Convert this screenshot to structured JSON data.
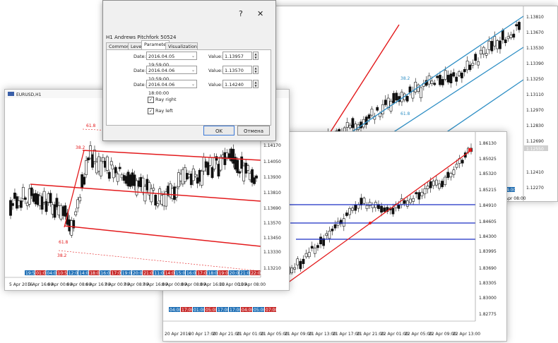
{
  "dialog": {
    "title": "H1 Andrews Pitchfork 50524",
    "help_label": "?",
    "close_label": "✕",
    "tabs": [
      "Common",
      "Levels",
      "Parameters",
      "Visualization"
    ],
    "active_tab": "Parameters",
    "rows": [
      {
        "date_label": "Date:",
        "date": "2016.04.05 19:59:00",
        "value_label": "Value:",
        "value": "1.13957"
      },
      {
        "date_label": "Date:",
        "date": "2016.04.06 10:59:00",
        "value_label": "Value:",
        "value": "1.13570"
      },
      {
        "date_label": "Date:",
        "date": "2016.04.06 18:00:00",
        "value_label": "Value:",
        "value": "1.14240"
      }
    ],
    "ray_right_label": "Ray right",
    "ray_left_label": "Ray left",
    "ray_right_checked": true,
    "ray_left_checked": true,
    "ok_label": "OK",
    "cancel_label": "Отмена"
  },
  "chart_back": {
    "price_labels": [
      "1.13810",
      "1.13670",
      "1.13530",
      "1.13390",
      "1.13250",
      "1.13110",
      "1.12970",
      "1.12830",
      "1.12690",
      "1.12550",
      "1.12410",
      "1.12270"
    ],
    "highlight_label": "1.12550",
    "fan_labels": [
      "38.2",
      "61.8"
    ],
    "time_badges": [
      "04:00",
      "Apr 08:00"
    ],
    "colors": {
      "fan": "#2f8fc5",
      "fork": "#e31a1c"
    }
  },
  "chart_left": {
    "symbol": "EURUSD,H1",
    "price_labels": [
      "1.14530",
      "1.14410",
      "1.14290",
      "1.14170",
      "1.14050",
      "1.13930",
      "1.13810",
      "1.13690",
      "1.13570",
      "1.13450",
      "1.13330",
      "1.13210"
    ],
    "dialog_cut_labels": [
      "530",
      "410",
      "290"
    ],
    "fork_labels": [
      "61.8",
      "38.2",
      "61.8",
      "38.2"
    ],
    "time_labels": [
      "5 Apr 2016",
      "5 Apr 16:00",
      "6 Apr 00:00",
      "6 Apr 08:00",
      "6 Apr 16:00",
      "7 Apr 00:00",
      "7 Apr 08:00",
      "7 Apr 16:00",
      "8 Apr 00:00",
      "8 Apr 08:00",
      "8 Apr 16:00",
      "11 Apr 00:00",
      "11 Apr 08:00"
    ],
    "time_badges": [
      "19:59",
      "01:00",
      "04:00",
      "10:59",
      "12:00",
      "14:00",
      "18:00",
      "16:00",
      "17:00",
      "19:00",
      "20:00",
      "21:00",
      "11:00",
      "14:00",
      "15:00",
      "16:00",
      "17:00",
      "18:00",
      "19:00",
      "20:00",
      "21:00",
      "22:00"
    ],
    "colors": {
      "fork": "#e31a1c",
      "badge_red": "#c62828",
      "badge_blue": "#1f6fb5"
    }
  },
  "chart_right": {
    "price_labels": [
      "1.86130",
      "1.85025",
      "1.85320",
      "1.85215",
      "1.84910",
      "1.84605",
      "1.84300",
      "1.83995",
      "1.83690",
      "1.83305",
      "1.83000",
      "1.82775"
    ],
    "time_labels": [
      "20 Apr 2016",
      "20 Apr 17:00",
      "20 Apr 21:00",
      "21 Apr 01:00",
      "21 Apr 05:00",
      "21 Apr 09:00",
      "21 Apr 13:00",
      "21 Apr 17:00",
      "21 Apr 21:00",
      "22 Apr 01:00",
      "22 Apr 05:00",
      "22 Apr 09:00",
      "22 Apr 13:00"
    ],
    "time_badges": [
      "04:00",
      "17:00",
      "01:00",
      "05:00",
      "17:00",
      "17:00",
      "04:00",
      "05:00",
      "07:00"
    ],
    "colors": {
      "blue": "#1a2fc4",
      "red": "#e31a1c"
    }
  }
}
